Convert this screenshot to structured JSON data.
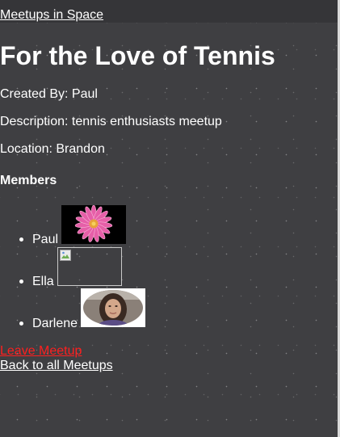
{
  "nav": {
    "brand_link": "Meetups in Space"
  },
  "meetup": {
    "title": "For the Love of Tennis",
    "created_by": "Created By: Paul",
    "description": "Description: tennis enthusiasts meetup",
    "location": "Location: Brandon"
  },
  "members": {
    "heading": "Members",
    "list": [
      {
        "name": "Paul",
        "avatar": "pink-flower-photo"
      },
      {
        "name": "Ella",
        "avatar": "broken-image-icon"
      },
      {
        "name": "Darlene",
        "avatar": "woman-portrait-photo"
      }
    ]
  },
  "actions": {
    "leave_label": "Leave Meetup",
    "back_label": "Back to all Meetups"
  },
  "colors": {
    "background": "#3f3f42",
    "topbar": "#353538",
    "text": "#ffffff",
    "leave_link": "#ff1f1f"
  }
}
